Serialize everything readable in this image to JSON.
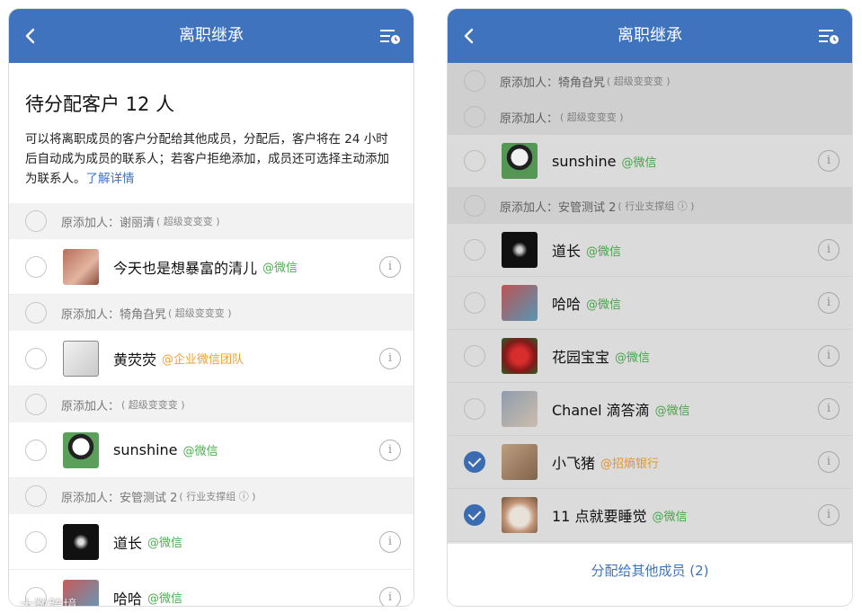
{
  "nav": {
    "title": "离职继承"
  },
  "intro": {
    "heading": "待分配客户 12 人",
    "body": "可以将离职成员的客户分配给其他成员，分配后，客户将在 24 小时后自动成为成员的联系人；若客户拒绝添加，成员还可选择主动添加为联系人。",
    "link": "了解详情"
  },
  "left_list": [
    {
      "kind": "group",
      "label": "原添加人：谢丽清",
      "sub": "( 超级变变变 )"
    },
    {
      "kind": "row",
      "name": "今天也是想暴富的清儿",
      "tag": "@微信",
      "tag_type": "wx",
      "avatar": "av-girl",
      "checked": false
    },
    {
      "kind": "group",
      "label": "原添加人：犄角旮旯",
      "sub": "( 超级变变变 )"
    },
    {
      "kind": "row",
      "name": "黄荧荧",
      "tag": "@企业微信团队",
      "tag_type": "org",
      "avatar": "av-sketch",
      "checked": false
    },
    {
      "kind": "group",
      "label": "原添加人：",
      "sub": "( 超级变变变 )"
    },
    {
      "kind": "row",
      "name": "sunshine",
      "tag": "@微信",
      "tag_type": "wx",
      "avatar": "av-panda",
      "checked": false
    },
    {
      "kind": "group",
      "label": "原添加人：安管测试 2",
      "sub": "( 行业支撑组 ⓘ )"
    },
    {
      "kind": "row",
      "name": "道长",
      "tag": "@微信",
      "tag_type": "wx",
      "avatar": "av-dark",
      "checked": false
    },
    {
      "kind": "row",
      "name": "哈哈",
      "tag": "@微信",
      "tag_type": "wx",
      "avatar": "av-haha",
      "checked": false
    }
  ],
  "right_list": [
    {
      "kind": "group",
      "label": "原添加人：犄角旮旯",
      "sub": "( 超级变变变 )"
    },
    {
      "kind": "group",
      "label": "原添加人：",
      "sub": "( 超级变变变 )"
    },
    {
      "kind": "row",
      "name": "sunshine",
      "tag": "@微信",
      "tag_type": "wx",
      "avatar": "av-panda",
      "checked": false
    },
    {
      "kind": "group",
      "label": "原添加人：安管测试 2",
      "sub": "( 行业支撑组 ⓘ )"
    },
    {
      "kind": "row",
      "name": "道长",
      "tag": "@微信",
      "tag_type": "wx",
      "avatar": "av-dark",
      "checked": false
    },
    {
      "kind": "row",
      "name": "哈哈",
      "tag": "@微信",
      "tag_type": "wx",
      "avatar": "av-haha",
      "checked": false
    },
    {
      "kind": "row",
      "name": "花园宝宝",
      "tag": "@微信",
      "tag_type": "wx",
      "avatar": "av-flower",
      "checked": false
    },
    {
      "kind": "row",
      "name": "Chanel 滴答滴",
      "tag": "@微信",
      "tag_type": "wx",
      "avatar": "av-cat",
      "checked": false
    },
    {
      "kind": "row",
      "name": "小飞猪",
      "tag": "@招熵银行",
      "tag_type": "org",
      "avatar": "av-pig",
      "checked": true
    },
    {
      "kind": "row",
      "name": "11 点就要睡觉",
      "tag": "@微信",
      "tag_type": "wx",
      "avatar": "av-dog",
      "checked": true
    }
  ],
  "footer": {
    "label": "分配给其他成员 (2)"
  },
  "info_glyph": "i",
  "icons": {
    "back": "chevron-left-icon",
    "menu": "list-clock-icon",
    "info": "info-icon"
  },
  "watermark": "大数跨境",
  "colors": {
    "accent": "#3f73bd",
    "wechat": "#4caf50",
    "org": "#f0a030"
  }
}
